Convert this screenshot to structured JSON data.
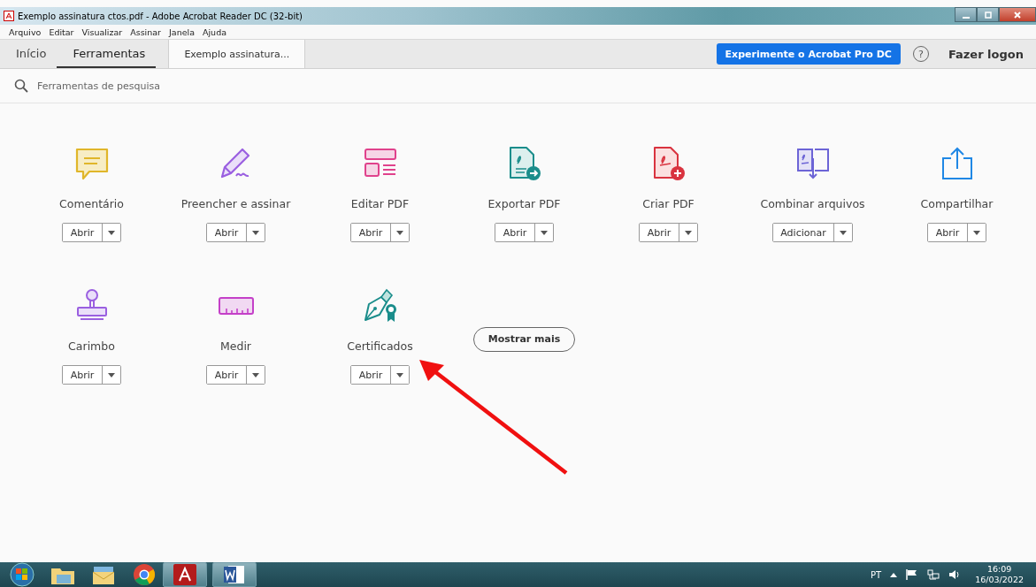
{
  "window": {
    "title": "Exemplo assinatura ctos.pdf - Adobe Acrobat Reader DC (32-bit)"
  },
  "menu": [
    "Arquivo",
    "Editar",
    "Visualizar",
    "Assinar",
    "Janela",
    "Ajuda"
  ],
  "tabs": [
    {
      "label": "Início",
      "selected": false
    },
    {
      "label": "Ferramentas",
      "selected": true
    }
  ],
  "document_tab": {
    "label": "Exemplo assinatura..."
  },
  "trial_button": "Experimente o Acrobat Pro DC",
  "help_icon": "?",
  "login": "Fazer logon",
  "search": {
    "placeholder": "Ferramentas de pesquisa"
  },
  "tools": [
    {
      "kind": "comment",
      "label": "Comentário",
      "button": "Abrir"
    },
    {
      "kind": "sign",
      "label": "Preencher e assinar",
      "button": "Abrir"
    },
    {
      "kind": "edit",
      "label": "Editar PDF",
      "button": "Abrir"
    },
    {
      "kind": "export",
      "label": "Exportar PDF",
      "button": "Abrir"
    },
    {
      "kind": "create",
      "label": "Criar PDF",
      "button": "Abrir"
    },
    {
      "kind": "combine",
      "label": "Combinar arquivos",
      "button": "Adicionar"
    },
    {
      "kind": "share",
      "label": "Compartilhar",
      "button": "Abrir"
    },
    {
      "kind": "stamp",
      "label": "Carimbo",
      "button": "Abrir"
    },
    {
      "kind": "measure",
      "label": "Medir",
      "button": "Abrir"
    },
    {
      "kind": "certificate",
      "label": "Certificados",
      "button": "Abrir"
    }
  ],
  "show_more": "Mostrar mais",
  "taskbar": {
    "language": "PT",
    "time": "16:09",
    "date": "16/03/2022"
  }
}
